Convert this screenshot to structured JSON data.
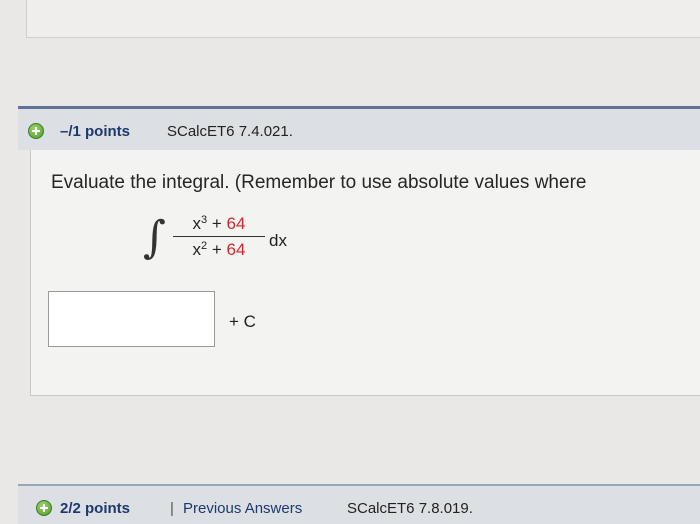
{
  "question1": {
    "points": "–/1 points",
    "code": "SCalcET6 7.4.021.",
    "prompt": "Evaluate the integral. (Remember to use absolute values where",
    "integrand": {
      "numerator_var": "x",
      "numerator_exp": "3",
      "numerator_op": "+",
      "numerator_const": "64",
      "denominator_var": "x",
      "denominator_exp": "2",
      "denominator_op": "+",
      "denominator_const": "64",
      "differential": "dx"
    },
    "answer_value": "",
    "constant_suffix": "+ C"
  },
  "question2": {
    "points": "2/2 points",
    "separator": "|",
    "previous_answers": "Previous Answers",
    "code": "SCalcET6 7.8.019."
  },
  "icons": {
    "expand": "plus-circle-icon"
  },
  "colors": {
    "accent": "#1c3a6d",
    "highlight": "#d3272b",
    "header_border": "#5e7397"
  }
}
